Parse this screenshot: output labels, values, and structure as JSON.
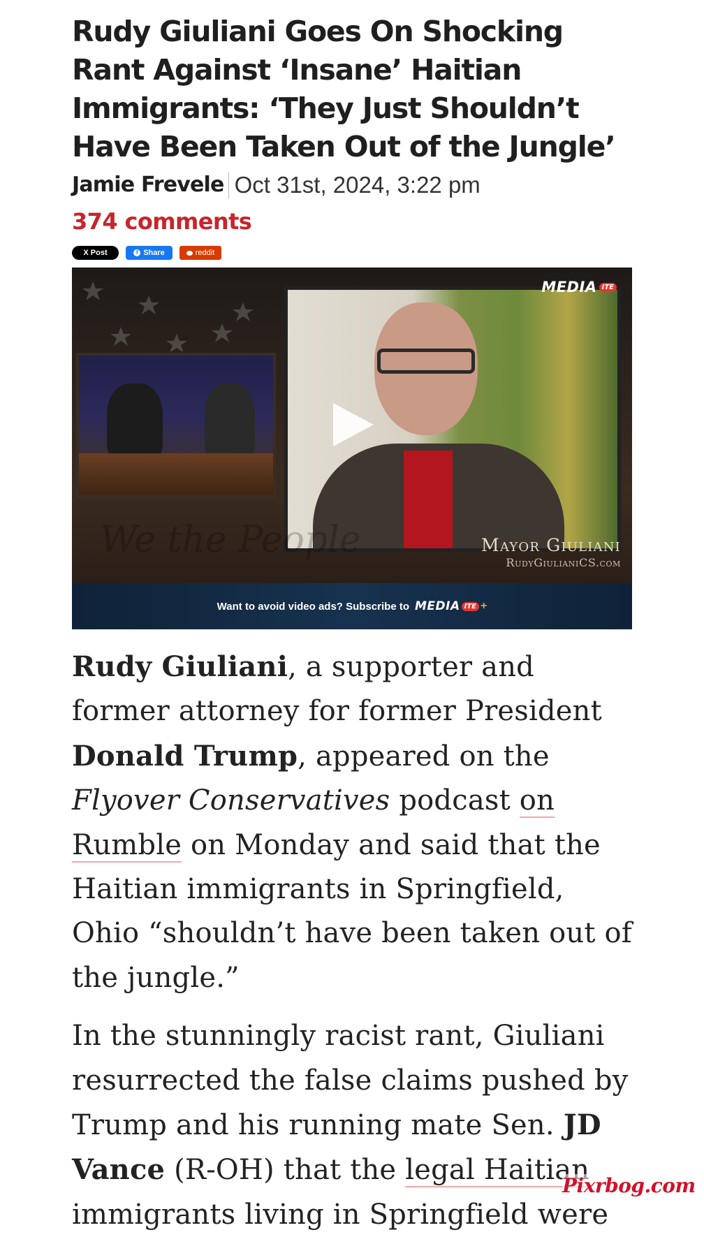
{
  "article": {
    "headline": "Rudy Giuliani Goes On Shocking Rant Against ‘Insane’ Haitian Immigrants: ‘They Just Shouldn’t Have Been Taken Out of the Jungle’",
    "author": "Jamie Frevele",
    "date": "Oct 31st, 2024, 3:22 pm",
    "comments": "374 comments"
  },
  "share": {
    "x_label": "X Post",
    "facebook_label": "Share",
    "reddit_label": "reddit"
  },
  "video": {
    "brand": "MEDIA",
    "brand_badge": "ITE",
    "caption_name": "Mayor Giuliani",
    "caption_site": "RudyGiulianiCS.com",
    "background_script": "We the People",
    "promo_text": "Want to avoid video ads? Subscribe to",
    "promo_brand": "MEDIA",
    "promo_badge": "ITE",
    "promo_plus": "+"
  },
  "paragraph1": {
    "p1": "Rudy Giuliani",
    "p2": ", a supporter and former attorney for former President ",
    "p3": "Donald Trump",
    "p4": ", appeared on the ",
    "p5": "Flyover Conservatives",
    "p6": " podcast ",
    "p7": "on Rumble",
    "p8": " on Monday and said that the Haitian immigrants in Springfield, Ohio “shouldn’t have been taken out of the jungle.”"
  },
  "paragraph2": {
    "p1": "In the stunningly racist rant, Giuliani resurrected the false claims pushed by Trump and his running mate Sen. ",
    "p2": "JD Vance",
    "p3": " (R-OH) that the ",
    "p4": "legal Haitian",
    "p5": " immigrants living in Springfield were"
  },
  "watermark": "Pixrbog.com",
  "colors": {
    "comments": "#c8252c",
    "facebook": "#1877f2",
    "reddit": "#d93a00",
    "promo_bg": "#17324f"
  }
}
